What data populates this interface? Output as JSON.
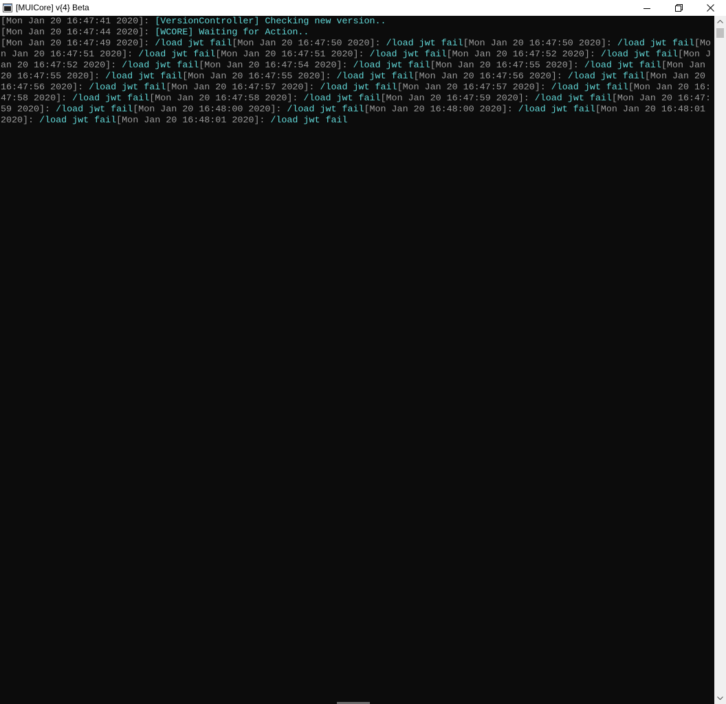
{
  "window": {
    "title": "[MUICore] v{4} Beta",
    "icon": "console-window-icon",
    "controls": {
      "minimize": "minimize-icon",
      "maximize": "restore-icon",
      "close": "close-icon"
    }
  },
  "colors": {
    "background": "#0c0c0c",
    "timestamp": "#9a9a9a",
    "message": "#61d6d6"
  },
  "console": {
    "lines": [
      {
        "segments": [
          {
            "kind": "ts",
            "text": "[Mon Jan 20 16:47:41 2020]: "
          },
          {
            "kind": "msg",
            "text": "[VersionController] Checking new version.."
          }
        ]
      },
      {
        "segments": [
          {
            "kind": "ts",
            "text": "[Mon Jan 20 16:47:44 2020]: "
          },
          {
            "kind": "msg",
            "text": "[WCORE] Waiting for Action.."
          }
        ]
      },
      {
        "segments": [
          {
            "kind": "ts",
            "text": "[Mon Jan 20 16:47:49 2020]: "
          },
          {
            "kind": "msg",
            "text": "/load jwt fail"
          },
          {
            "kind": "ts",
            "text": "[Mon Jan 20 16:47:50 2020]: "
          },
          {
            "kind": "msg",
            "text": "/load jwt fail"
          },
          {
            "kind": "ts",
            "text": "[Mon Jan 20 16:47:50 2020]: "
          },
          {
            "kind": "msg",
            "text": "/load jwt fail"
          },
          {
            "kind": "ts",
            "text": "[Mon Jan 20 16:47:51 2020]: "
          },
          {
            "kind": "msg",
            "text": "/load jwt fail"
          },
          {
            "kind": "ts",
            "text": "[Mon Jan 20 16:47:51 2020]: "
          },
          {
            "kind": "msg",
            "text": "/load jwt fail"
          },
          {
            "kind": "ts",
            "text": "[Mon Jan 20 16:47:52 2020]: "
          },
          {
            "kind": "msg",
            "text": "/load jwt fail"
          },
          {
            "kind": "ts",
            "text": "[Mon Jan 20 16:47:52 2020]: "
          },
          {
            "kind": "msg",
            "text": "/load jwt fail"
          },
          {
            "kind": "ts",
            "text": "[Mon Jan 20 16:47:54 2020]: "
          },
          {
            "kind": "msg",
            "text": "/load jwt fail"
          },
          {
            "kind": "ts",
            "text": "[Mon Jan 20 16:47:55 2020]: "
          },
          {
            "kind": "msg",
            "text": "/load jwt fail"
          },
          {
            "kind": "ts",
            "text": "[Mon Jan 20 16:47:55 2020]: "
          },
          {
            "kind": "msg",
            "text": "/load jwt fail"
          },
          {
            "kind": "ts",
            "text": "[Mon Jan 20 16:47:55 2020]: "
          },
          {
            "kind": "msg",
            "text": "/load jwt fail"
          },
          {
            "kind": "ts",
            "text": "[Mon Jan 20 16:47:56 2020]: "
          },
          {
            "kind": "msg",
            "text": "/load jwt fail"
          },
          {
            "kind": "ts",
            "text": "[Mon Jan 20 16:47:56 2020]: "
          },
          {
            "kind": "msg",
            "text": "/load jwt fail"
          },
          {
            "kind": "ts",
            "text": "[Mon Jan 20 16:47:57 2020]: "
          },
          {
            "kind": "msg",
            "text": "/load jwt fail"
          },
          {
            "kind": "ts",
            "text": "[Mon Jan 20 16:47:57 2020]: "
          },
          {
            "kind": "msg",
            "text": "/load jwt fail"
          },
          {
            "kind": "ts",
            "text": "[Mon Jan 20 16:47:58 2020]: "
          },
          {
            "kind": "msg",
            "text": "/load jwt fail"
          },
          {
            "kind": "ts",
            "text": "[Mon Jan 20 16:47:58 2020]: "
          },
          {
            "kind": "msg",
            "text": "/load jwt fail"
          },
          {
            "kind": "ts",
            "text": "[Mon Jan 20 16:47:59 2020]: "
          },
          {
            "kind": "msg",
            "text": "/load jwt fail"
          },
          {
            "kind": "ts",
            "text": "[Mon Jan 20 16:47:59 2020]: "
          },
          {
            "kind": "msg",
            "text": "/load jwt fail"
          },
          {
            "kind": "ts",
            "text": "[Mon Jan 20 16:48:00 2020]: "
          },
          {
            "kind": "msg",
            "text": "/load jwt fail"
          },
          {
            "kind": "ts",
            "text": "[Mon Jan 20 16:48:00 2020]: "
          },
          {
            "kind": "msg",
            "text": "/load jwt fail"
          },
          {
            "kind": "ts",
            "text": "[Mon Jan 20 16:48:01 2020]: "
          },
          {
            "kind": "msg",
            "text": "/load jwt fail"
          },
          {
            "kind": "ts",
            "text": "[Mon Jan 20 16:48:01 2020]: "
          },
          {
            "kind": "msg",
            "text": "/load jwt fail"
          }
        ]
      }
    ]
  }
}
